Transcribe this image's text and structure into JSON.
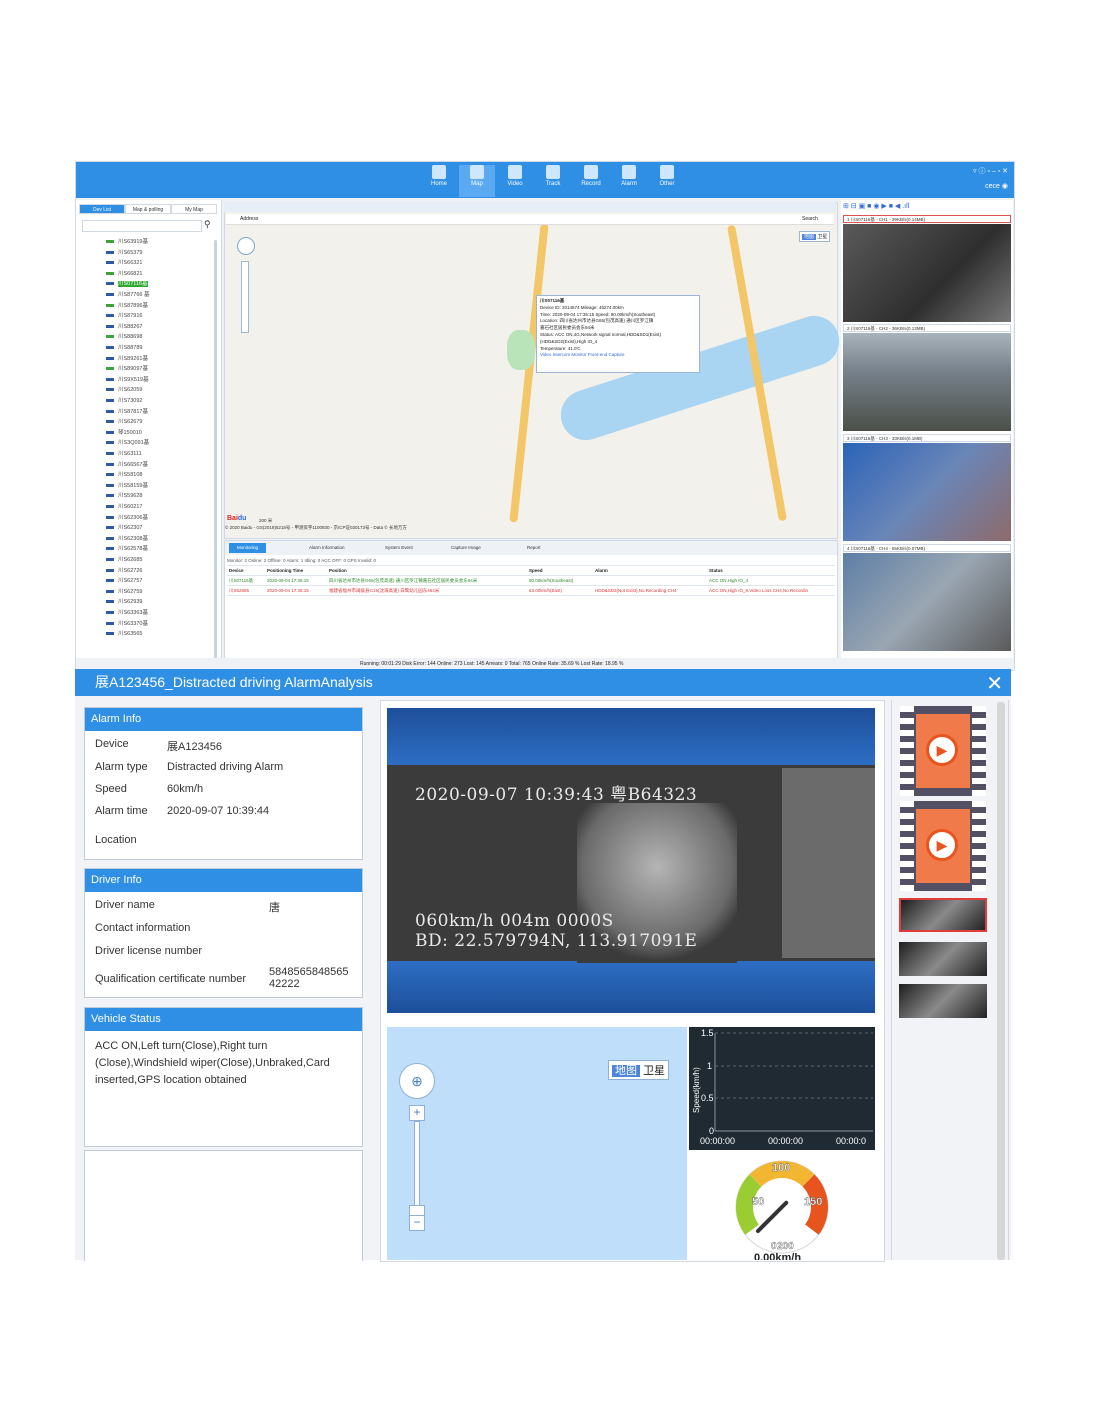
{
  "top_app": {
    "nav": [
      {
        "label": "Home"
      },
      {
        "label": "Map"
      },
      {
        "label": "Video"
      },
      {
        "label": "Track"
      },
      {
        "label": "Record"
      },
      {
        "label": "Alarm"
      },
      {
        "label": "Other"
      }
    ],
    "user": "cece",
    "left_tabs": [
      "Dev List",
      "Map & polling",
      "My Map"
    ],
    "vehicles": [
      "川S63919基",
      "川S65379",
      "川S66321",
      "川S66821",
      "川S07116基",
      "川S87766 基",
      "川S87896基",
      "川S87916",
      "川S88267",
      "川S88698",
      "川S88789",
      "川S89261基",
      "川S89097基",
      "川S9X519基",
      "川S62059",
      "川S73092",
      "川S87817基",
      "川S62679",
      "琴150010",
      "川S3Q091基",
      "川S63111",
      "川S66567基",
      "川S58108",
      "川S58159基",
      "川S59628",
      "川S60217",
      "川S62306基",
      "川S62307",
      "川S62308基",
      "川S62578基",
      "川S62685",
      "川S62726",
      "川S62757",
      "川S62759",
      "川S62939",
      "川S63363基",
      "川S63370基",
      "川S63565"
    ],
    "map_addr_label": "Address",
    "map_search_label": "Search",
    "map_type": [
      "地图",
      "卫星"
    ],
    "popup": {
      "title": "川S07116基",
      "lines": [
        "Device ID: 2014574 Mileage: 45274.00km",
        "Time: 2020-09-04 17:35:15 Speed: 80.00km/h(Southeast)",
        "Location: 四川省达州市达县G65(包茂高速) 通川区罗江镇",
        "嘉石社区居民委员会东94米",
        "Status: ACC ON,4G,Network signal normal,HDD&SD1(Exist)",
        "(HDD&SD2(Exist),High IO_4",
        "Temperature: 41.0'C",
        "Video  Intercom  Monitor  Front-end Capture"
      ]
    },
    "map_footer": "© 2020 Baidu - GS(2019)5218号 - 甲测资字1100930 - 京ICP证030173号 - Data © 长地万方",
    "scale": "200 米",
    "mon_tabs": [
      "Monitoring",
      "Alarm Information",
      "System Event",
      "Capture Image",
      "Report"
    ],
    "mon_summary": "Monitor: 2  Online: 2  Offline: 0  Alarm: 1  Idling: 0  ACC OFF: 0  GPS Invalid: 0",
    "mon_headers": [
      "Device",
      "Positioning Time",
      "Position",
      "Speed",
      "Alarm",
      "Status"
    ],
    "mon_rows": [
      [
        "川S07116基",
        "2020-09-04 17:35:15",
        "四川省达州市达县G65(包茂高速) 通川区罗江镇嘉石社区居民委员会东94米",
        "80.00km/h(Southeast)",
        "",
        "ACC ON,High IO_4"
      ],
      [
        "川S62665",
        "2020-09-04 17:35:15",
        "福建省福州市闽侯县G15(沈海高速) 白鹭幼儿园东464米",
        "63.00km/h(East)",
        "HDD&SD2(Not Exist),No Recording CH4",
        "ACC ON,High IO_8,Video Loss CH4,No Recordin"
      ]
    ],
    "cam_heads": [
      "1   川S07116基 - CH1 - 39KB/s(0.14MB)",
      "2   川S07116基 - CH2 - 36KB/s(0.13MB)",
      "3   川S07116基 - CH3 - 33KB/s(0.1MB)",
      "4   川S07116基 - CH4 - 55KB/s(0.07MB)"
    ],
    "status_bar": "Running: 00:01:29   Disk Error: 144   Online: 273   Lost: 145   Arrears: 0   Total: 765   Online Rate: 35.69 %   Lost Rate: 18.95 %"
  },
  "analysis": {
    "title": "展A123456_Distracted driving AlarmAnalysis",
    "alarm_info": {
      "heading": "Alarm Info",
      "rows": [
        {
          "label": "Device",
          "value": "展A123456"
        },
        {
          "label": "Alarm type",
          "value": "Distracted driving Alarm"
        },
        {
          "label": "Speed",
          "value": "60km/h"
        },
        {
          "label": "Alarm time",
          "value": "2020-09-07 10:39:44"
        },
        {
          "label": "Location",
          "value": ""
        }
      ]
    },
    "driver_info": {
      "heading": "Driver Info",
      "rows": [
        {
          "label": "Driver name",
          "value": "唐"
        },
        {
          "label": "Contact information",
          "value": ""
        },
        {
          "label": "Driver license number",
          "value": ""
        },
        {
          "label": "Qualification certificate number",
          "value": "5848565848565\n42222"
        }
      ]
    },
    "vehicle_status": {
      "heading": "Vehicle Status",
      "text": "ACC ON,Left turn(Close),Right turn (Close),Windshield wiper(Close),Unbraked,Card inserted,GPS location obtained"
    },
    "video_osd": {
      "time": "2020-09-07  10:39:43  粤B64323",
      "speed": "060km/h  004m  0000S",
      "gps": "BD:  22.579794N, 113.917091E"
    },
    "map_type": [
      "地图",
      "卫星"
    ],
    "speed_chart": {
      "ylabel": "Speed(km/h)",
      "yticks": [
        "1.5",
        "1",
        "0.5",
        "0"
      ],
      "xticks": [
        "00:00:00",
        "00:00:00",
        "00:00:0"
      ]
    },
    "gauge": {
      "ticks": [
        "50",
        "100",
        "150"
      ],
      "zero": "0",
      "max": "200",
      "readout": "0.00km/h",
      "value_kmh": 0,
      "colors": {
        "low": "#9acd32",
        "mid": "#f2b632",
        "high": "#e8541e"
      }
    }
  },
  "colors": {
    "accent": "#2f8fe5",
    "alarm_red": "#e03c3c",
    "green": "#2faa2f"
  }
}
